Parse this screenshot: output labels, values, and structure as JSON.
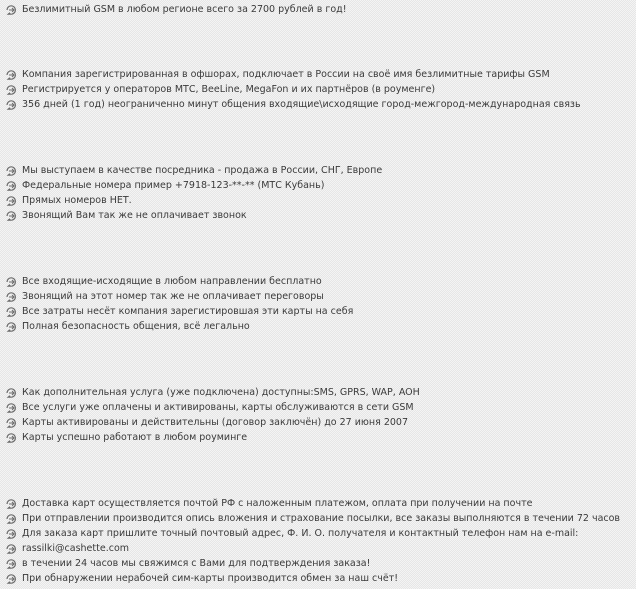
{
  "icon": "circular-arrow-bullet-icon",
  "colors": {
    "text": "#3a3a3a",
    "background": "#f4f4f4",
    "icon": "#6a6a6a"
  },
  "lines": [
    "Безлимитный GSM в любом регионе всего за 2700 рублей в год!",
    "Компания зарегистрированная в офшорах, подключает в России на своё имя безлимитные тарифы GSM",
    "Регистрируется у операторов МТС, BeeLine, MegaFon и их партнёров (в роуменге)",
    "356 дней (1 год) неограниченно минут общения входящие\\исходящие город-межгород-международная связь",
    "Мы выступаем в качестве посредника - продажа в России, СНГ, Европе",
    "Федеральные номера пример +7918-123-**-** (МТС Кубань)",
    "Прямых номеров НЕТ.",
    "Звонящий Вам так же не оплачивает звонок",
    "Все входящие-исходящие в любом направлении бесплатно",
    "Звонящий на этот номер так же не оплачивает переговоры",
    "Все затраты несёт компания зарегистировшая эти карты на себя",
    "Полная безопасность общения, всё легально",
    "Как дополнительная услуга (уже подключена) доступны:SMS, GPRS, WAP, AOH",
    "Все услуги уже оплачены и активированы, карты обслуживаются в сети GSM",
    "Карты активированы и действительны (договор заключён) до 27 июня 2007",
    "Карты успешно работают в любом роуминге",
    "Доставка карт осуществляется почтой РФ с наложенным платежом, оплата при получении на почте",
    "При отправлении производится опись вложения и страхование посылки, все заказы выполняются в течении 72 часов",
    "Для заказа карт пришлите точный почтовый адрес, Ф. И. О. получателя и контактный телефон нам на e-mail:",
    "rassilki@cashette.com",
    "в течении 24 часов мы свяжимся с Вами для подтверждения заказа!",
    "При обнаружении нерабочей сим-карты производится обмен за наш счёт!"
  ]
}
